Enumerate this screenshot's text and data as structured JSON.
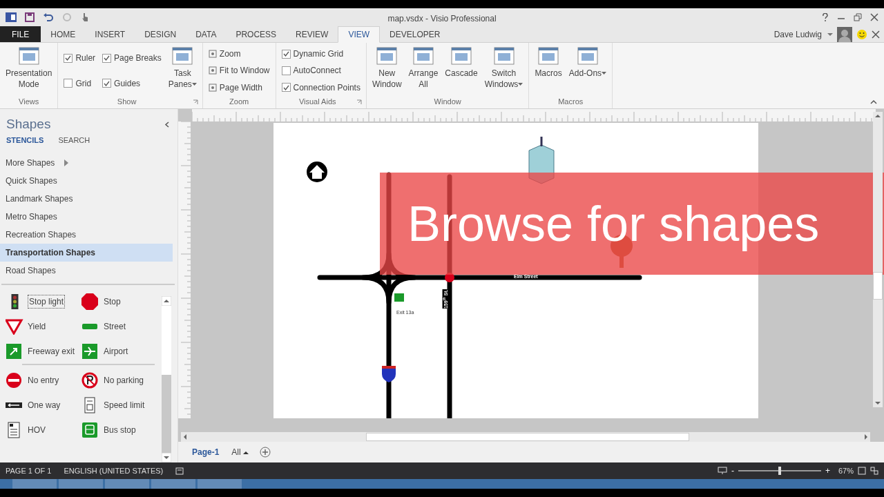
{
  "window": {
    "title": "map.vsdx - Visio Professional"
  },
  "ribbon_tabs": [
    {
      "label": "FILE",
      "kind": "file",
      "selected": false
    },
    {
      "label": "HOME",
      "kind": "tab",
      "selected": false
    },
    {
      "label": "INSERT",
      "kind": "tab",
      "selected": false
    },
    {
      "label": "DESIGN",
      "kind": "tab",
      "selected": false
    },
    {
      "label": "DATA",
      "kind": "tab",
      "selected": false
    },
    {
      "label": "PROCESS",
      "kind": "tab",
      "selected": false
    },
    {
      "label": "REVIEW",
      "kind": "tab",
      "selected": false
    },
    {
      "label": "VIEW",
      "kind": "tab",
      "selected": true
    },
    {
      "label": "DEVELOPER",
      "kind": "tab",
      "selected": false
    }
  ],
  "user": {
    "name": "Dave Ludwig"
  },
  "ribbon_groups": [
    {
      "label": "Views",
      "launcher": false,
      "columns": [
        [
          {
            "kind": "large",
            "label": "Presentation Mode",
            "dropdown": false
          }
        ]
      ]
    },
    {
      "label": "Show",
      "launcher": true,
      "columns": [
        [
          {
            "kind": "check",
            "label": "Ruler",
            "checked": true
          },
          {
            "kind": "check",
            "label": "Grid",
            "checked": false
          }
        ],
        [
          {
            "kind": "check",
            "label": "Page Breaks",
            "checked": true
          },
          {
            "kind": "check",
            "label": "Guides",
            "checked": true
          }
        ],
        [
          {
            "kind": "large",
            "label": "Task Panes",
            "dropdown": true
          }
        ]
      ]
    },
    {
      "label": "Zoom",
      "launcher": false,
      "columns": [
        [
          {
            "kind": "small",
            "label": "Zoom"
          },
          {
            "kind": "small",
            "label": "Fit to Window"
          },
          {
            "kind": "small",
            "label": "Page Width"
          }
        ]
      ]
    },
    {
      "label": "Visual Aids",
      "launcher": true,
      "columns": [
        [
          {
            "kind": "check",
            "label": "Dynamic Grid",
            "checked": true
          },
          {
            "kind": "check",
            "label": "AutoConnect",
            "checked": false
          },
          {
            "kind": "check",
            "label": "Connection Points",
            "checked": true
          }
        ]
      ]
    },
    {
      "label": "Window",
      "launcher": false,
      "columns": [
        [
          {
            "kind": "large",
            "label": "New Window",
            "dropdown": false
          }
        ],
        [
          {
            "kind": "large",
            "label": "Arrange All",
            "dropdown": false
          }
        ],
        [
          {
            "kind": "large",
            "label": "Cascade",
            "dropdown": false
          }
        ],
        [
          {
            "kind": "large",
            "label": "Switch Windows",
            "dropdown": true
          }
        ]
      ]
    },
    {
      "label": "Macros",
      "launcher": false,
      "columns": [
        [
          {
            "kind": "large",
            "label": "Macros",
            "dropdown": false
          }
        ],
        [
          {
            "kind": "large",
            "label": "Add-Ons",
            "dropdown": true
          }
        ]
      ]
    }
  ],
  "shapes_pane": {
    "title": "Shapes",
    "tabs": [
      {
        "label": "STENCILS",
        "selected": true
      },
      {
        "label": "SEARCH",
        "selected": false
      }
    ],
    "stencils": [
      {
        "label": "More Shapes",
        "kind": "submenu",
        "selected": false
      },
      {
        "label": "Quick Shapes",
        "kind": "stencil",
        "selected": false
      },
      {
        "label": "Landmark Shapes",
        "kind": "stencil",
        "selected": false
      },
      {
        "label": "Metro Shapes",
        "kind": "stencil",
        "selected": false
      },
      {
        "label": "Recreation Shapes",
        "kind": "stencil",
        "selected": false
      },
      {
        "label": "Transportation Shapes",
        "kind": "stencil",
        "selected": true
      },
      {
        "label": "Road Shapes",
        "kind": "stencil",
        "selected": false
      }
    ],
    "shape_sections": [
      [
        {
          "label": "Stop light",
          "kind": "stoplight",
          "focused": true
        },
        {
          "label": "Stop",
          "kind": "stop",
          "focused": false
        },
        {
          "label": "Yield",
          "kind": "yield",
          "focused": false
        },
        {
          "label": "Street",
          "kind": "street",
          "focused": false
        },
        {
          "label": "Freeway exit",
          "kind": "exit",
          "focused": false
        },
        {
          "label": "Airport",
          "kind": "airport",
          "focused": false
        }
      ],
      [
        {
          "label": "No entry",
          "kind": "noentry",
          "focused": false
        },
        {
          "label": "No parking",
          "kind": "noparking",
          "focused": false
        },
        {
          "label": "One way",
          "kind": "oneway",
          "focused": false
        },
        {
          "label": "Speed limit",
          "kind": "speed",
          "focused": false
        },
        {
          "label": "HOV",
          "kind": "hov",
          "focused": false
        },
        {
          "label": "Bus stop",
          "kind": "bus",
          "focused": false
        }
      ]
    ]
  },
  "map": {
    "labels": [
      {
        "text": "Elm Street",
        "kind": "street"
      },
      {
        "text": "Exit 13a",
        "kind": "exit"
      },
      {
        "text": "159$^{th}$ St.",
        "kind": "vertical"
      }
    ]
  },
  "caption_banner": {
    "text": "Browse for shapes"
  },
  "page_tabs": [
    {
      "label": "Page-1",
      "kind": "page",
      "selected": true
    },
    {
      "label": "All",
      "kind": "all",
      "selected": false
    }
  ],
  "status_bar": {
    "page": "PAGE 1 OF 1",
    "language": "ENGLISH (UNITED STATES)",
    "zoom_out": "-",
    "zoom_in": "+",
    "zoom": "67%",
    "zoom_slider": {
      "level": 0.5
    }
  }
}
